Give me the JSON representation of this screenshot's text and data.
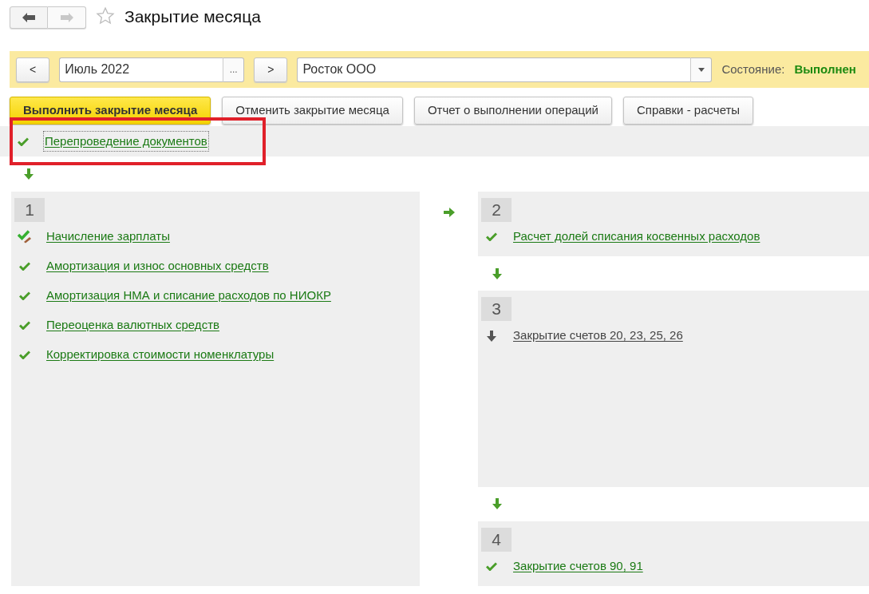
{
  "window": {
    "title": "Закрытие месяца",
    "favorite": false
  },
  "toolbar": {
    "prev": "<",
    "period": "Июль 2022",
    "period_button": "...",
    "next": ">",
    "organization": "Росток ООО",
    "state_label": "Состояние:",
    "state_value": "Выполнен"
  },
  "actions": [
    {
      "label": "Выполнить закрытие месяца",
      "kind": "primary"
    },
    {
      "label": "Отменить закрытие месяца",
      "kind": "default"
    },
    {
      "label": "Отчет о выполнении операций",
      "kind": "default"
    },
    {
      "label": "Справки - расчеты",
      "kind": "default"
    }
  ],
  "reposting": {
    "label": "Перепроведение документов",
    "kind": "done",
    "highlighted": true
  },
  "left_column": {
    "stages": [
      {
        "number": "1",
        "items": [
          {
            "label": "Начисление зарплаты",
            "kind": "edited"
          },
          {
            "label": "Амортизация и износ основных средств",
            "kind": "done"
          },
          {
            "label": "Амортизация НМА и списание расходов по НИОКР",
            "kind": "done"
          },
          {
            "label": "Переоценка валютных средств",
            "kind": "done"
          },
          {
            "label": "Корректировка стоимости номенклатуры",
            "kind": "done"
          }
        ]
      }
    ]
  },
  "right_column": {
    "stages": [
      {
        "number": "2",
        "items": [
          {
            "label": "Расчет долей списания косвенных расходов",
            "kind": "done"
          }
        ]
      },
      {
        "number": "3",
        "items": [
          {
            "label": "Закрытие счетов 20, 23, 25, 26",
            "kind": "pending"
          }
        ]
      },
      {
        "number": "4",
        "items": [
          {
            "label": "Закрытие счетов 90, 91",
            "kind": "done"
          }
        ]
      }
    ]
  }
}
